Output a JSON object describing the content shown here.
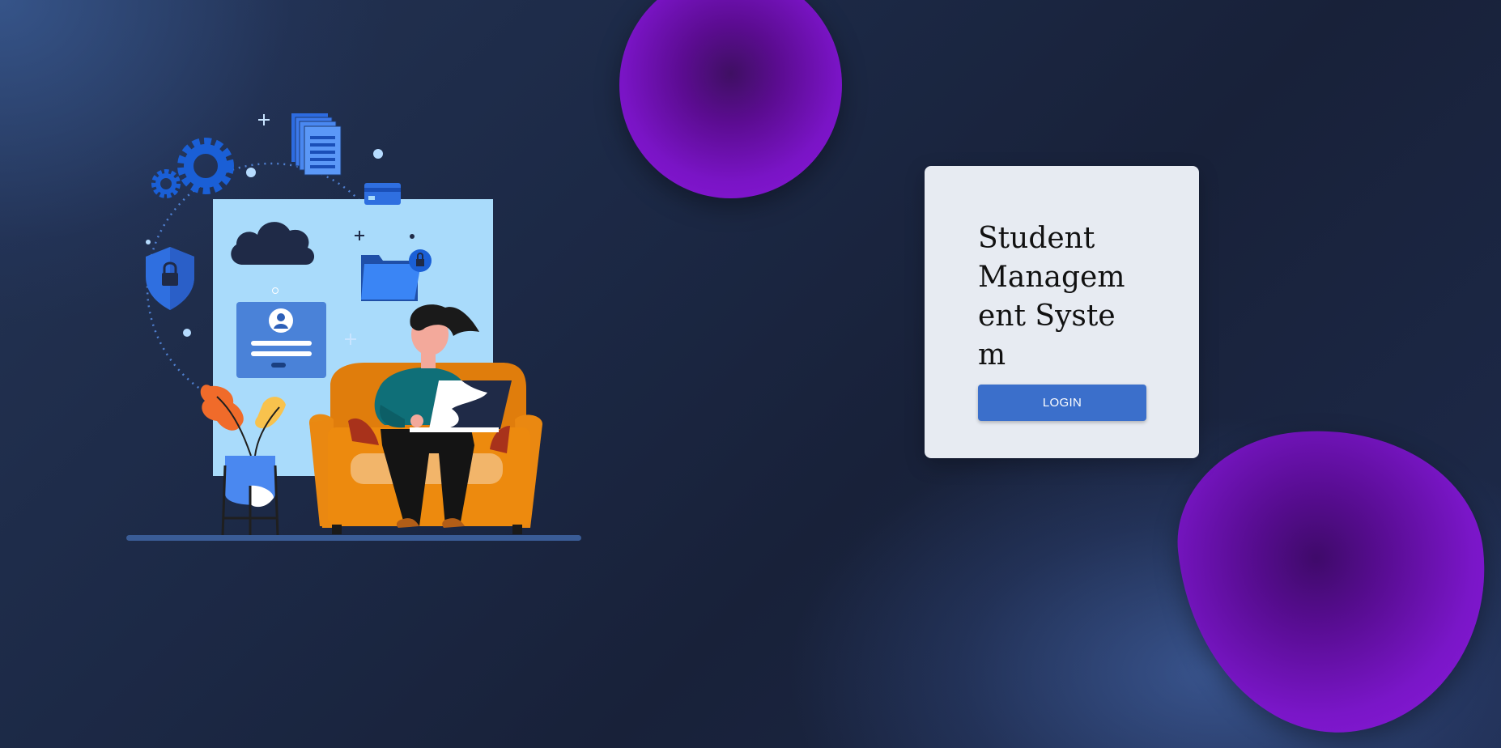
{
  "card": {
    "title": "Student Management System",
    "login_label": "LOGIN"
  },
  "colors": {
    "background": "#1c2946",
    "blob": "#7a14c6",
    "card": "#e7ebf2",
    "button": "#3b6fcb"
  },
  "icons": [
    "gear-icon",
    "document-stack-icon",
    "cloud-icon",
    "credit-card-icon",
    "folder-lock-icon",
    "shield-lock-icon",
    "user-login-form-icon"
  ]
}
